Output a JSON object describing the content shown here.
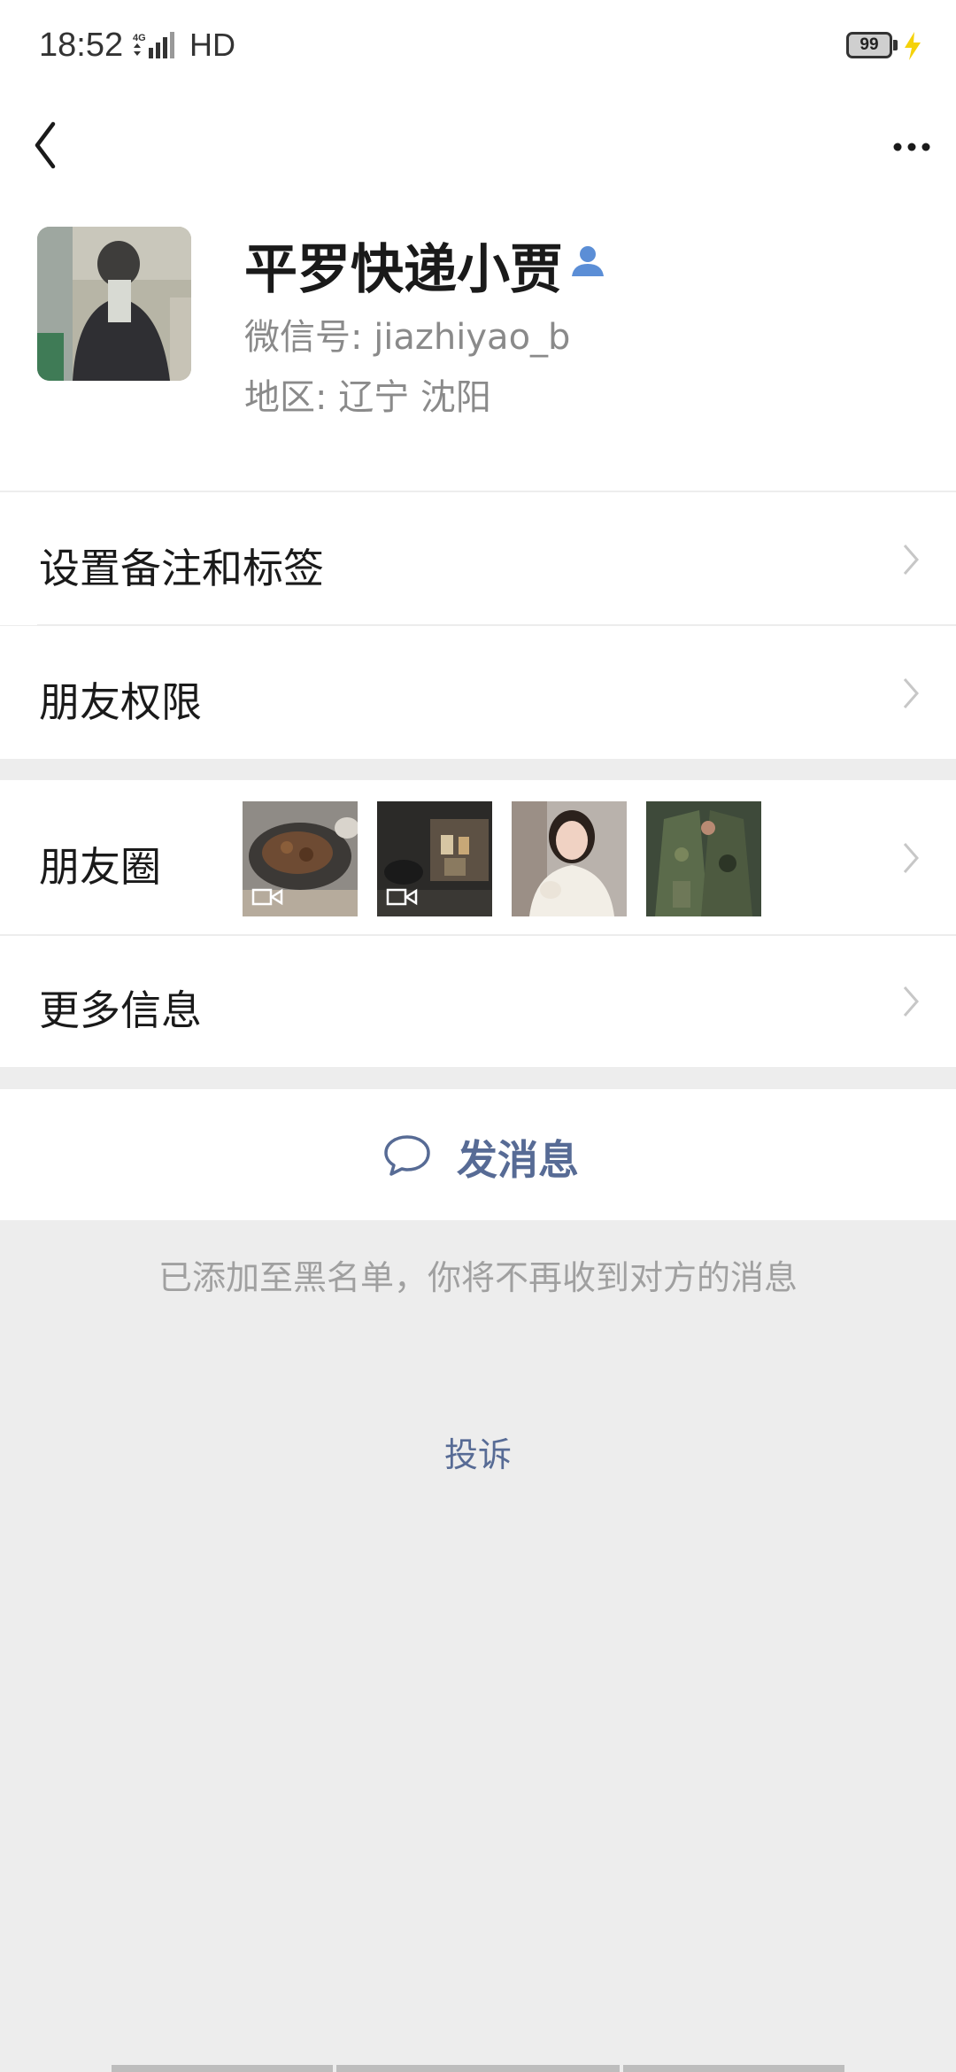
{
  "status_bar": {
    "time": "18:52",
    "network": "4G",
    "hd": "HD",
    "battery": "99"
  },
  "nav": {
    "back_icon": "chevron-left-icon",
    "more_icon": "more-horizontal-icon"
  },
  "profile": {
    "nickname": "平罗快递小贾",
    "wechat_id": "微信号: jiazhiyao_b",
    "region": "地区: 辽宁  沈阳",
    "verify_icon": "user-icon"
  },
  "menu": {
    "remark_tags": "设置备注和标签",
    "permissions": "朋友权限",
    "moments": "朋友圈",
    "more_info": "更多信息"
  },
  "send": {
    "label": "发消息",
    "icon": "chat-bubble-icon"
  },
  "footer": {
    "blacklist_notice": "已添加至黑名单，你将不再收到对方的消息",
    "complain": "投诉"
  },
  "colors": {
    "link": "#576b95",
    "background": "#ededed",
    "verify": "#5b8ed6",
    "charge": "#f5d20a"
  }
}
